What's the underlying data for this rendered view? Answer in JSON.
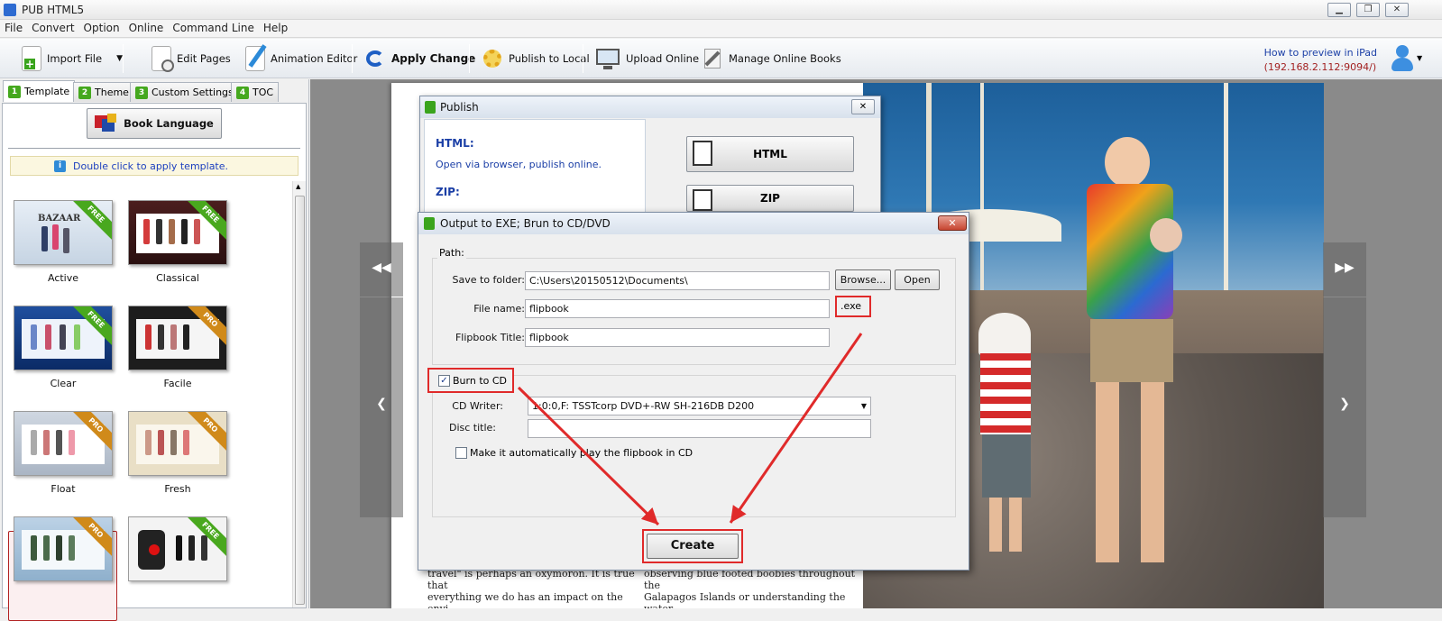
{
  "window": {
    "title": "PUB HTML5",
    "minimize": "▁",
    "restore": "❐",
    "close": "✕"
  },
  "menu": [
    "File",
    "Convert",
    "Option",
    "Online",
    "Command Line",
    "Help"
  ],
  "toolbar": {
    "import_file": "Import File",
    "edit_pages": "Edit Pages",
    "animation_editor": "Animation Editor",
    "apply_change": "Apply Change",
    "publish_to_local": "Publish to Local",
    "upload_online": "Upload Online",
    "manage_online_books": "Manage Online Books",
    "preview_line1": "How to preview in iPad",
    "preview_line2": "(192.168.2.112:9094/)"
  },
  "left_panel": {
    "tabs": [
      {
        "num": "1",
        "label": "Template"
      },
      {
        "num": "2",
        "label": "Theme"
      },
      {
        "num": "3",
        "label": "Custom Settings"
      },
      {
        "num": "4",
        "label": "TOC"
      }
    ],
    "book_language": "Book Language",
    "hint": "Double click to apply template.",
    "templates": [
      {
        "label": "Active",
        "badge": "FREE"
      },
      {
        "label": "Classical",
        "badge": "FREE"
      },
      {
        "label": "Clear",
        "badge": "FREE"
      },
      {
        "label": "Facile",
        "badge": "PRO"
      },
      {
        "label": "Float",
        "badge": "PRO"
      },
      {
        "label": "Fresh",
        "badge": "PRO"
      },
      {
        "label": "",
        "badge": "PRO"
      },
      {
        "label": "",
        "badge": "FREE"
      }
    ],
    "thumb_text": "BAZAAR"
  },
  "book": {
    "left_text_1": "travel\" is perhaps an oxymoron. It is true that",
    "left_text_2": "everything we do has an impact on the envi-",
    "right_text_1": "observing blue footed boobies throughout the",
    "right_text_2": "Galapagos Islands or understanding the water"
  },
  "publish": {
    "title": "Publish",
    "html_heading": "HTML:",
    "html_desc": "Open via browser, publish online.",
    "zip_heading": "ZIP:",
    "html_button": "HTML",
    "zip_button": "ZIP"
  },
  "output_dialog": {
    "title": "Output to EXE; Brun to CD/DVD",
    "close": "✕",
    "path_group": "Path:",
    "save_to_folder_label": "Save to folder:",
    "save_to_folder_value": "C:\\Users\\20150512\\Documents\\",
    "browse": "Browse...",
    "open": "Open",
    "file_name_label": "File name:",
    "file_name_value": "flipbook",
    "extension": ".exe",
    "flipbook_title_label": "Flipbook Title:",
    "flipbook_title_value": "flipbook",
    "burn_to_cd": "Burn to CD",
    "cd_writer_label": "CD Writer:",
    "cd_writer_value": "1:0:0,F: TSSTcorp DVD+-RW SH-216DB D200",
    "disc_title_label": "Disc title:",
    "disc_title_value": "",
    "auto_play": "Make it automatically play the flipbook in CD",
    "create": "Create",
    "check": "✓"
  },
  "nav": {
    "first": "◀◀",
    "last": "▶▶",
    "prev": "❮",
    "next": "❯"
  },
  "colors": {
    "accent_red": "#e02a2a",
    "link_blue": "#1b3fa6",
    "tab_green": "#45a81e"
  }
}
